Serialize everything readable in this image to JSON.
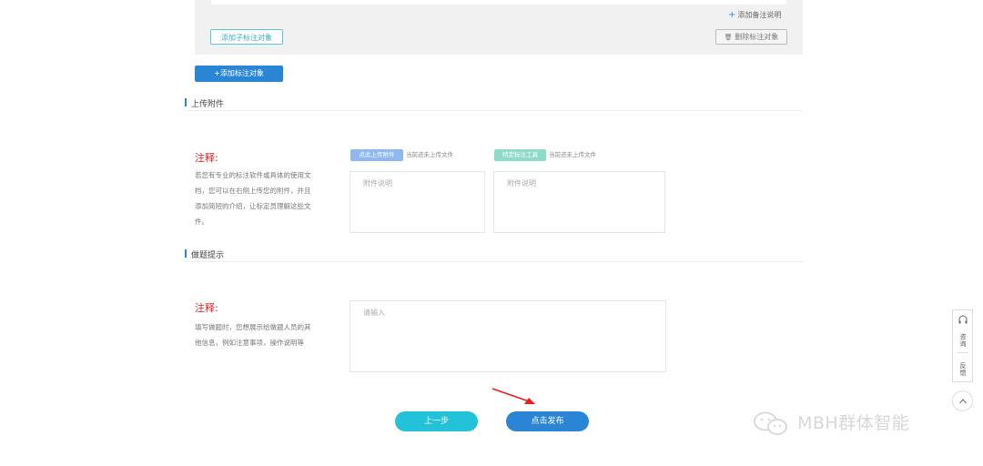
{
  "panel": {
    "add_remark_label": "添加备注说明",
    "add_sub_target_label": "添加子标注对象",
    "delete_target_label": "删除标注对象"
  },
  "add_target_label": "添加标注对象",
  "upload_section": {
    "title": "上传附件",
    "note_label": "注释:",
    "note_text": "若您有专业的标注软件或具体的使用文档，您可以在右侧上传您的附件，并且添加简短的介绍，让标定员理解这些文件。",
    "upload_attachment_label": "点此上传附件",
    "upload_attachment_status": "当前还未上传文件",
    "specific_tool_label": "特定标注工具",
    "specific_tool_status": "当前还未上传文件",
    "attachment_desc_placeholder": "附件说明",
    "tool_desc_placeholder": "附件说明"
  },
  "hint_section": {
    "title": "做题提示",
    "note_label": "注释:",
    "note_text": "填写做题时，您想展示给做题人员的其他信息，例如注意事项，操作说明等",
    "input_placeholder": "请输入"
  },
  "actions": {
    "prev_label": "上一步",
    "publish_label": "点击发布"
  },
  "side": {
    "consult_label": "咨询",
    "feedback_label": "反馈"
  },
  "watermark_text": "MBH群体智能",
  "colors": {
    "primary": "#2a86d4",
    "teal": "#22c2d8",
    "warning_red": "#e02020",
    "arrow_red": "#e61e1e"
  }
}
